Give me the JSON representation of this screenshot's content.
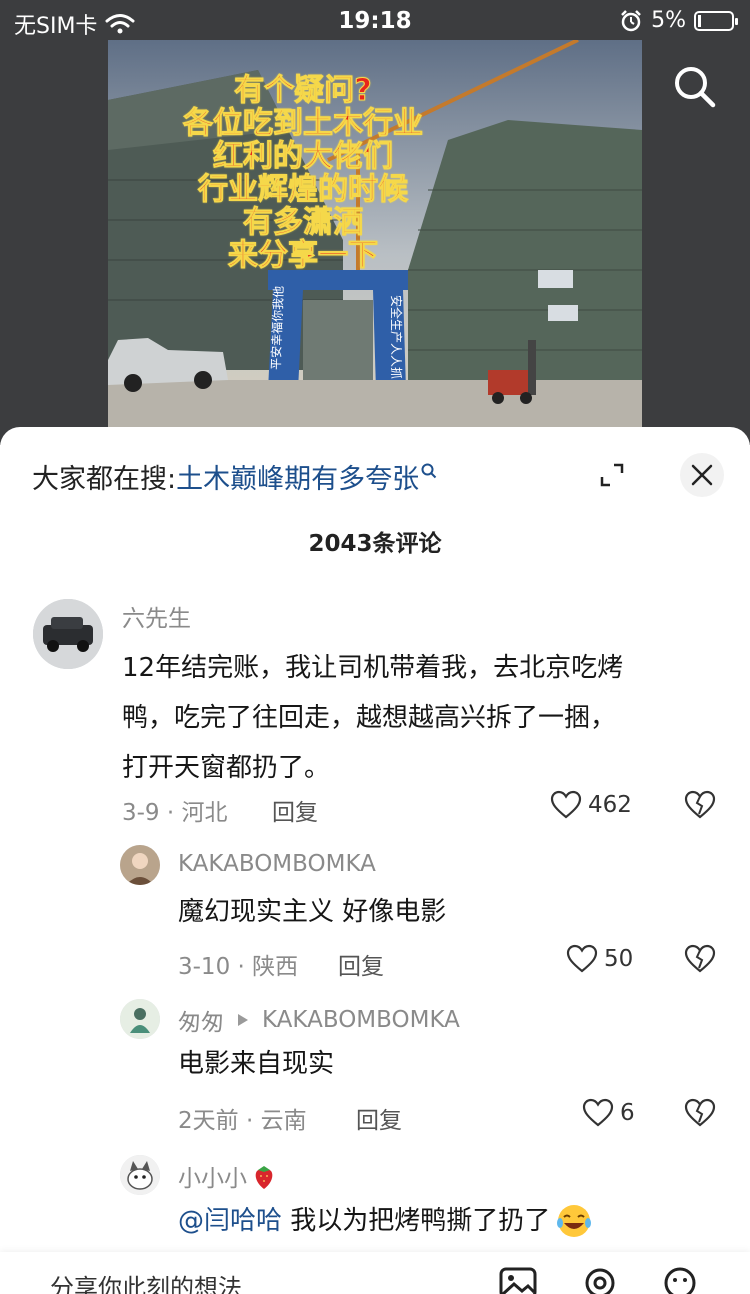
{
  "status": {
    "carrier": "无SIM卡",
    "time": "19:18",
    "battery_percent": "5%",
    "battery_level": 0.05
  },
  "video": {
    "overlay_lines": [
      "有个疑问?",
      "各位吃到土木行业",
      "红利的大佬们",
      "行业辉煌的时候",
      "有多潇洒",
      "来分享一下"
    ],
    "gate_left_text": "平安幸福你我他",
    "gate_right_text": "安全生产人人抓"
  },
  "sheet": {
    "search_prefix": "大家都在搜:",
    "search_term": "土木巅峰期有多夸张",
    "comment_count": "2043条评论"
  },
  "comments": [
    {
      "name": "六先生",
      "text_lines": [
        "12年结完账，我让司机带着我，去北京吃烤",
        "鸭，吃完了往回走，越想越高兴拆了一捆，",
        "打开天窗都扔了。"
      ],
      "meta": "3-9 · 河北",
      "reply_label": "回复",
      "likes": "462"
    },
    {
      "name": "KAKABOMBOMKA",
      "text": "魔幻现实主义 好像电影",
      "meta": "3-10 · 陕西",
      "reply_label": "回复",
      "likes": "50"
    },
    {
      "name": "匆匆",
      "reply_to": "KAKABOMBOMKA",
      "text": "电影来自现实",
      "meta": "2天前 · 云南",
      "reply_label": "回复",
      "likes": "6"
    },
    {
      "name": "小小小",
      "mention": "@闫哈哈",
      "text": " 我以为把烤鸭撕了扔了"
    }
  ],
  "input": {
    "placeholder": "分享你此刻的想法"
  },
  "colors": {
    "accent_blue": "#1d4f8c",
    "overlay_red": "#e8261b",
    "overlay_outline": "#f5d84a"
  }
}
